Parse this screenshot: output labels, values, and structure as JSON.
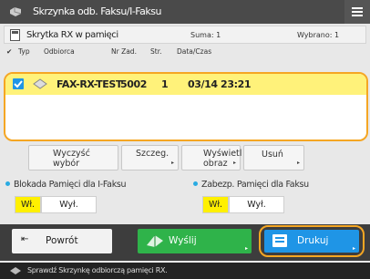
{
  "title": "Skrzynka odb. Faksu/I-Faksu",
  "storage": {
    "label": "Skrytka RX w pamięci",
    "total": "Suma: 1",
    "selected": "Wybrano: 1"
  },
  "columns": [
    "Typ",
    "Odbiorca",
    "Nr Zad.",
    "Str.",
    "Data/Czas"
  ],
  "rows": [
    {
      "sender": "FAX-RX-TEST",
      "job": "5002",
      "pages": "1",
      "datetime": "03/14  23:21",
      "selected": true
    }
  ],
  "buttons": {
    "clear": "Wyczyść wybór",
    "details": "Szczeg.",
    "display": "Wyświetl obraz",
    "delete": "Usuń"
  },
  "lock_ifax": {
    "label": "Blokada Pamięci dla I-Faksu",
    "on": "Wł.",
    "off": "Wył.",
    "state": "on"
  },
  "lock_fax": {
    "label": "Zabezp. Pamięci dla Faksu",
    "on": "Wł.",
    "off": "Wył.",
    "state": "on"
  },
  "back": "Powrót",
  "send": "Wyślij",
  "print": "Drukuj",
  "status": "Sprawdź Skrzynkę odbiorczą pamięci RX.",
  "colors": {
    "accent": "#f5a623",
    "highlight": "#fff27a",
    "send": "#2fb34a",
    "print": "#1f95e6",
    "toggle_on": "#fff000"
  }
}
